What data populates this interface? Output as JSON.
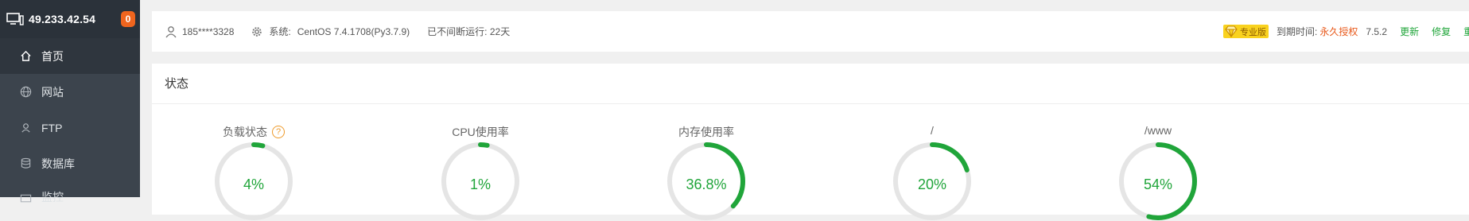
{
  "brand": {
    "ip": "49.233.42.54",
    "badge": "0"
  },
  "sidebar": {
    "items": [
      {
        "label": "首页",
        "icon": "home-icon",
        "active": true
      },
      {
        "label": "网站",
        "icon": "globe-icon"
      },
      {
        "label": "FTP",
        "icon": "ftp-icon"
      },
      {
        "label": "数据库",
        "icon": "database-icon"
      },
      {
        "label": "监控",
        "icon": "monitor-icon"
      }
    ]
  },
  "topbar": {
    "user": "185****3328",
    "system_label": "系统:",
    "system_value": "CentOS 7.4.1708(Py3.7.9)",
    "uptime": "已不间断运行: 22天",
    "pro_tag": "专业版",
    "expire_label": "到期时间:",
    "expire_value": "永久授权",
    "version": "7.5.2",
    "update": "更新",
    "repair": "修复",
    "restart": "重"
  },
  "status": {
    "title": "状态",
    "gauges": [
      {
        "name": "负载状态",
        "value": "4%",
        "percent": 4,
        "help": "?"
      },
      {
        "name": "CPU使用率",
        "value": "1%",
        "percent": 1
      },
      {
        "name": "内存使用率",
        "value": "36.8%",
        "percent": 36.8
      },
      {
        "name": "/",
        "value": "20%",
        "percent": 20
      },
      {
        "name": "/www",
        "value": "54%",
        "percent": 54
      }
    ]
  },
  "colors": {
    "accent": "#20a53a",
    "sidebar": "#3c444d",
    "badge": "#f0651e",
    "warn": "#e8591b"
  }
}
